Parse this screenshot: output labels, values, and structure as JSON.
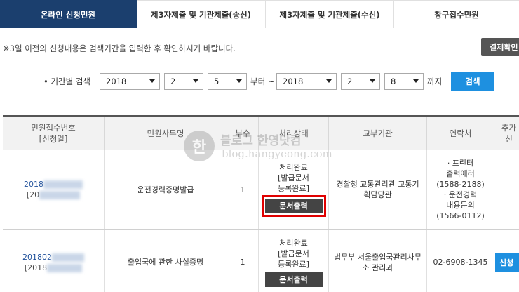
{
  "tabs": [
    {
      "label": "온라인 신청민원",
      "active": true
    },
    {
      "label": "제3자제출 및 기관제출(송신)",
      "active": false
    },
    {
      "label": "제3자제출 및 기관제출(수신)",
      "active": false
    },
    {
      "label": "창구접수민원",
      "active": false
    }
  ],
  "notice": "※3일 이전의 신청내용은 검색기간을 입력한 후 확인하시기 바랍니다.",
  "confirm_button": "결제확인",
  "search": {
    "label": "• 기간별 검색",
    "from_year": "2018",
    "from_month": "2",
    "from_day": "5",
    "from_suffix": "부터 ~",
    "to_year": "2018",
    "to_month": "2",
    "to_day": "8",
    "to_suffix": "까지",
    "button": "검색"
  },
  "table": {
    "headers": {
      "receipt_no": "민원접수번호",
      "receipt_date": "[신청일]",
      "service": "민원사무명",
      "copies": "부수",
      "status": "처리상태",
      "agency": "교부기관",
      "contact": "연락처",
      "extra": "추가신"
    },
    "rows": [
      {
        "receipt_no": "2018",
        "receipt_date": "[20",
        "service": "운전경력증명발급",
        "copies": "1",
        "status1": "처리완료",
        "status2": "[발급문서",
        "status3": "등록완료]",
        "print_button": "문서출력",
        "agency": "경찰청 교통관리관 교통기획담당관",
        "contact1": "· 프린터",
        "contact2": "출력에러",
        "contact3": "(1588-2188)",
        "contact4": "· 운전경력",
        "contact5": "내용문의",
        "contact6": "(1566-0112)"
      },
      {
        "receipt_no": "201802",
        "receipt_date": "[2018",
        "service": "출입국에 관한 사실증명",
        "copies": "1",
        "status1": "처리완료",
        "status2": "[발급문서",
        "status3": "등록완료]",
        "print_button": "문서출력",
        "agency": "법무부 서울출입국관리사무소 관리과",
        "contact": "02-6908-1345",
        "apply_button": "신청"
      }
    ]
  },
  "watermark": {
    "logo_char": "한",
    "title": "블로그 한영닷컴",
    "url": "blog.hangyeong.com"
  },
  "colors": {
    "active_tab": "#1b3f6e",
    "search_button": "#1e90e0",
    "print_button": "#444444",
    "highlight_border": "#e00000"
  }
}
